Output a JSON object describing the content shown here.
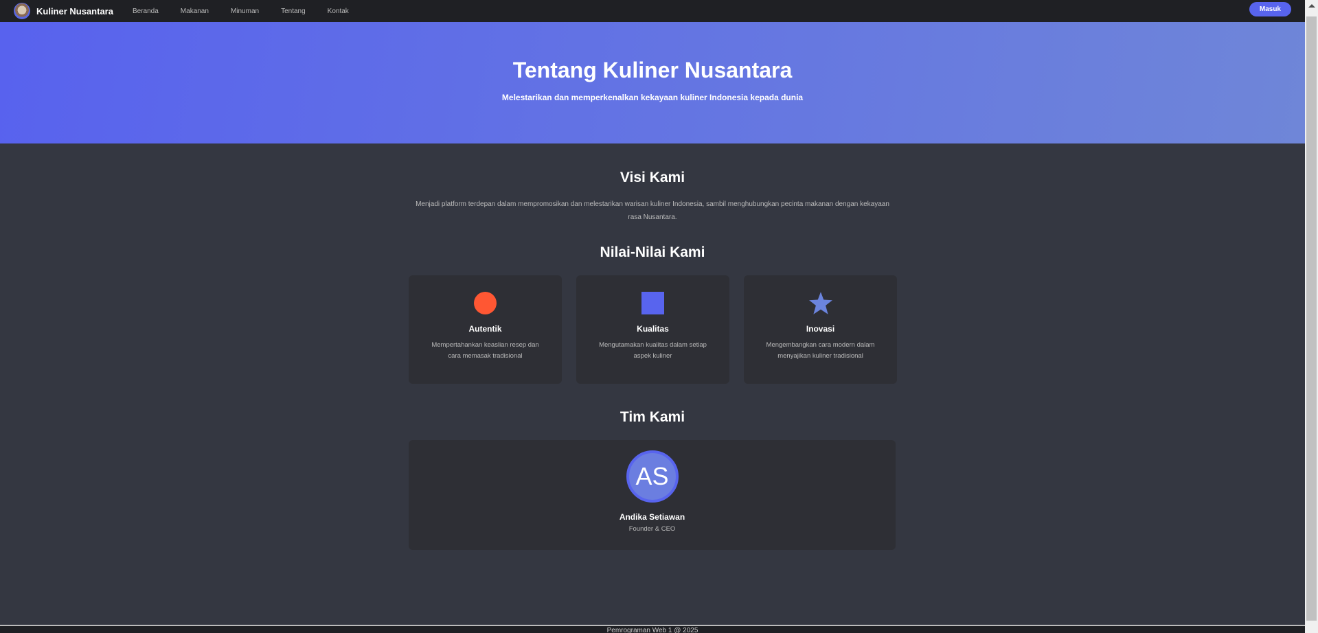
{
  "nav": {
    "brand": "Kuliner Nusantara",
    "links": [
      "Beranda",
      "Makanan",
      "Minuman",
      "Tentang",
      "Kontak"
    ],
    "login": "Masuk"
  },
  "hero": {
    "title": "Tentang Kuliner Nusantara",
    "subtitle": "Melestarikan dan memperkenalkan kekayaan kuliner Indonesia kepada dunia"
  },
  "visi": {
    "title": "Visi Kami",
    "text": "Menjadi platform terdepan dalam mempromosikan dan melestarikan warisan kuliner Indonesia, sambil menghubungkan pecinta makanan dengan kekayaan rasa Nusantara."
  },
  "nilai": {
    "title": "Nilai-Nilai Kami",
    "items": [
      {
        "icon": "circle",
        "color": "#ff5733",
        "title": "Autentik",
        "text": "Mempertahankan keaslian resep dan cara memasak tradisional"
      },
      {
        "icon": "square",
        "color": "#5864ee",
        "title": "Kualitas",
        "text": "Mengutamakan kualitas dalam setiap aspek kuliner"
      },
      {
        "icon": "star",
        "color": "#6b84de",
        "title": "Inovasi",
        "text": "Mengembangkan cara modern dalam menyajikan kuliner tradisional"
      }
    ]
  },
  "tim": {
    "title": "Tim Kami",
    "members": [
      {
        "initials": "AS",
        "name": "Andika Setiawan",
        "role": "Founder & CEO"
      }
    ]
  },
  "footer": {
    "text": "Pemrograman Web 1 @ 2025"
  }
}
